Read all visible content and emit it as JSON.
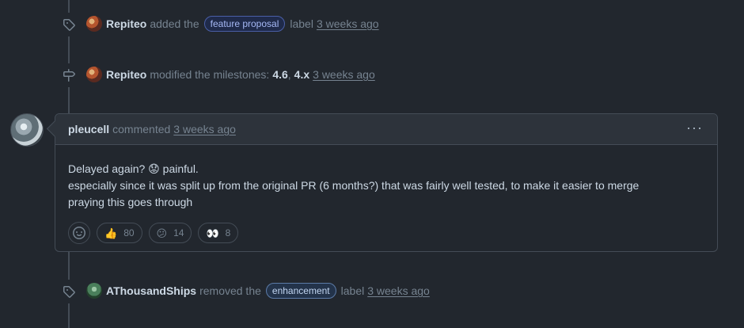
{
  "events": [
    {
      "author": "Repiteo",
      "action": "added the",
      "label": "feature proposal",
      "suffix": "label",
      "time": "3 weeks ago",
      "icon": "tag-icon"
    },
    {
      "author": "Repiteo",
      "action": "modified the milestones:",
      "milestone_a": "4.6",
      "sep": ",",
      "milestone_b": "4.x",
      "time": "3 weeks ago",
      "icon": "milestone-icon"
    },
    {
      "author": "AThousandShips",
      "action": "removed the",
      "label": "enhancement",
      "suffix": "label",
      "time": "3 weeks ago",
      "icon": "tag-icon"
    }
  ],
  "comment": {
    "author": "pleucell",
    "verb": "commented",
    "time": "3 weeks ago",
    "menu": "···",
    "lines": [
      "Delayed again? 😟 painful.",
      "especially since it was split up from the original PR (6 months?) that was fairly well tested, to make it easier to merge",
      "praying this goes through"
    ],
    "reactions": [
      {
        "emoji": "👍",
        "count": "80",
        "name": "thumbs-up"
      },
      {
        "emoji": "😕",
        "count": "14",
        "name": "confused"
      },
      {
        "emoji": "👀",
        "count": "8",
        "name": "eyes"
      }
    ]
  },
  "colors": {
    "background": "#22272e",
    "border": "#444c56",
    "muted": "#768390",
    "text": "#cdd9e5"
  }
}
